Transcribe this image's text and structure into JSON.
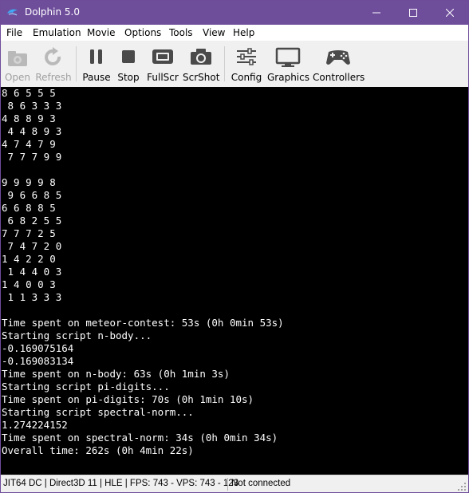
{
  "window": {
    "title": "Dolphin 5.0",
    "title_bar_color": "#6e4d9b",
    "icon": "dolphin-icon",
    "controls": [
      "minimize-icon",
      "maximize-icon",
      "close-icon"
    ]
  },
  "menu": {
    "items": [
      "File",
      "Emulation",
      "Movie",
      "Options",
      "Tools",
      "View",
      "Help"
    ]
  },
  "toolbar": {
    "buttons": [
      {
        "label": "Open",
        "icon": "folder-icon",
        "enabled": false
      },
      {
        "label": "Refresh",
        "icon": "refresh-icon",
        "enabled": false
      },
      {
        "label": "Pause",
        "icon": "pause-icon",
        "enabled": true
      },
      {
        "label": "Stop",
        "icon": "stop-icon",
        "enabled": true
      },
      {
        "label": "FullScr",
        "icon": "fullscreen-icon",
        "enabled": true
      },
      {
        "label": "ScrShot",
        "icon": "camera-icon",
        "enabled": true
      },
      {
        "label": "Config",
        "icon": "sliders-icon",
        "enabled": true
      },
      {
        "label": "Graphics",
        "icon": "monitor-icon",
        "enabled": true
      },
      {
        "label": "Controllers",
        "icon": "gamepad-icon",
        "enabled": true
      }
    ]
  },
  "console": {
    "background": "#000000",
    "text_color": "#ffffff",
    "lines": [
      "8 6 5 5 5",
      " 8 6 3 3 3",
      "4 8 8 9 3",
      " 4 4 8 9 3",
      "4 7 4 7 9",
      " 7 7 7 9 9",
      "",
      "9 9 9 9 8",
      " 9 6 6 8 5",
      "6 6 8 8 5",
      " 6 8 2 5 5",
      "7 7 7 2 5",
      " 7 4 7 2 0",
      "1 4 2 2 0",
      " 1 4 4 0 3",
      "1 4 0 0 3",
      " 1 1 3 3 3",
      "",
      "Time spent on meteor-contest: 53s (0h 0min 53s)",
      "Starting script n-body...",
      "-0.169075164",
      "-0.169083134",
      "Time spent on n-body: 63s (0h 1min 3s)",
      "Starting script pi-digits...",
      "Time spent on pi-digits: 70s (0h 1min 10s)",
      "Starting script spectral-norm...",
      "1.274224152",
      "Time spent on spectral-norm: 34s (0h 0min 34s)",
      "Overall time: 262s (0h 4min 22s)"
    ]
  },
  "status": {
    "left": "JIT64 DC | Direct3D 11 | HLE | FPS: 743 - VPS: 743 - 123",
    "right": "Not connected"
  }
}
